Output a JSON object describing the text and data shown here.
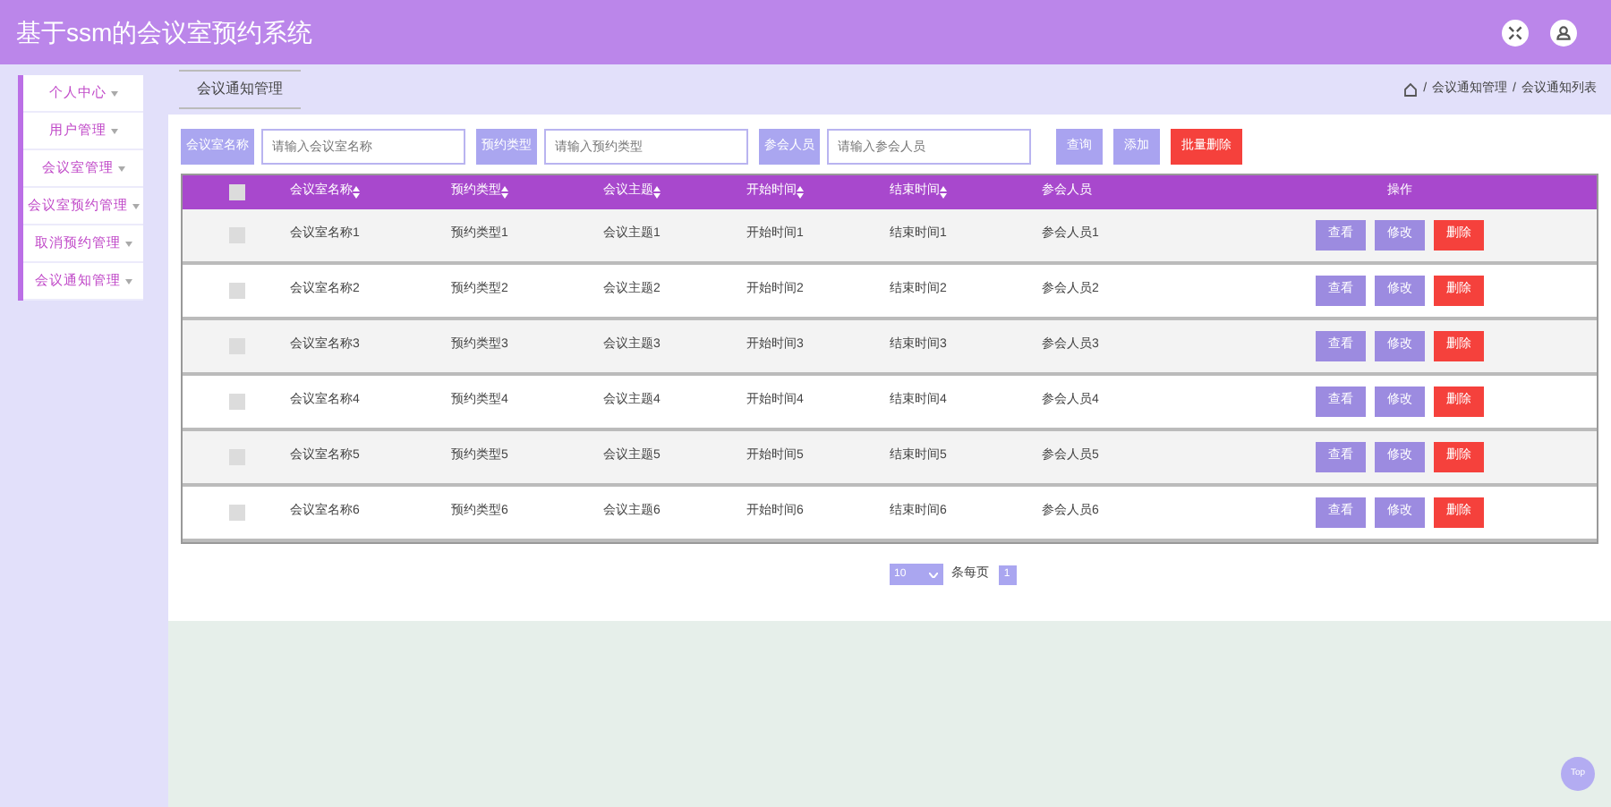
{
  "header": {
    "title": "基于ssm的会议室预约系统"
  },
  "sidebar": {
    "items": [
      {
        "label": "个人中心"
      },
      {
        "label": "用户管理"
      },
      {
        "label": "会议室管理"
      },
      {
        "label": "会议室预约管理"
      },
      {
        "label": "取消预约管理"
      },
      {
        "label": "会议通知管理"
      }
    ]
  },
  "tab": {
    "label": "会议通知管理"
  },
  "breadcrumb": [
    {
      "separator": "/",
      "label": "会议通知管理"
    },
    {
      "separator": "/",
      "label": "会议通知列表"
    }
  ],
  "search": {
    "fields": [
      {
        "label": "会议室名称",
        "placeholder": "请输入会议室名称"
      },
      {
        "label": "预约类型",
        "placeholder": "请输入预约类型"
      },
      {
        "label": "参会人员",
        "placeholder": "请输入参会人员"
      }
    ],
    "buttons": [
      {
        "label": "查询",
        "kind": "normal"
      },
      {
        "label": "添加",
        "kind": "normal"
      },
      {
        "label": "批量删除",
        "kind": "danger"
      }
    ]
  },
  "table": {
    "header_checked": false,
    "columns": [
      {
        "label": "会议室名称",
        "sortable": true
      },
      {
        "label": "预约类型",
        "sortable": true
      },
      {
        "label": "会议主题",
        "sortable": true
      },
      {
        "label": "开始时间",
        "sortable": true
      },
      {
        "label": "结束时间",
        "sortable": true
      },
      {
        "label": "参会人员",
        "sortable": false
      },
      {
        "label": "操作",
        "sortable": false
      }
    ],
    "rows": [
      {
        "checked": false,
        "cells": [
          "会议室名称1",
          "预约类型1",
          "会议主题1",
          "开始时间1",
          "结束时间1",
          "参会人员1"
        ],
        "actions": [
          {
            "label": "查看",
            "kind": "normal"
          },
          {
            "label": "修改",
            "kind": "normal"
          },
          {
            "label": "删除",
            "kind": "danger"
          }
        ]
      },
      {
        "checked": false,
        "cells": [
          "会议室名称2",
          "预约类型2",
          "会议主题2",
          "开始时间2",
          "结束时间2",
          "参会人员2"
        ],
        "actions": [
          {
            "label": "查看",
            "kind": "normal"
          },
          {
            "label": "修改",
            "kind": "normal"
          },
          {
            "label": "删除",
            "kind": "danger"
          }
        ]
      },
      {
        "checked": false,
        "cells": [
          "会议室名称3",
          "预约类型3",
          "会议主题3",
          "开始时间3",
          "结束时间3",
          "参会人员3"
        ],
        "actions": [
          {
            "label": "查看",
            "kind": "normal"
          },
          {
            "label": "修改",
            "kind": "normal"
          },
          {
            "label": "删除",
            "kind": "danger"
          }
        ]
      },
      {
        "checked": false,
        "cells": [
          "会议室名称4",
          "预约类型4",
          "会议主题4",
          "开始时间4",
          "结束时间4",
          "参会人员4"
        ],
        "actions": [
          {
            "label": "查看",
            "kind": "normal"
          },
          {
            "label": "修改",
            "kind": "normal"
          },
          {
            "label": "删除",
            "kind": "danger"
          }
        ]
      },
      {
        "checked": false,
        "cells": [
          "会议室名称5",
          "预约类型5",
          "会议主题5",
          "开始时间5",
          "结束时间5",
          "参会人员5"
        ],
        "actions": [
          {
            "label": "查看",
            "kind": "normal"
          },
          {
            "label": "修改",
            "kind": "normal"
          },
          {
            "label": "删除",
            "kind": "danger"
          }
        ]
      },
      {
        "checked": false,
        "cells": [
          "会议室名称6",
          "预约类型6",
          "会议主题6",
          "开始时间6",
          "结束时间6",
          "参会人员6"
        ],
        "actions": [
          {
            "label": "查看",
            "kind": "normal"
          },
          {
            "label": "修改",
            "kind": "normal"
          },
          {
            "label": "删除",
            "kind": "danger"
          }
        ]
      }
    ]
  },
  "pagination": {
    "page_size": "10",
    "page_size_label": "条每页",
    "pages": [
      {
        "label": "1",
        "selected": true
      }
    ]
  },
  "top_button": "Top"
}
